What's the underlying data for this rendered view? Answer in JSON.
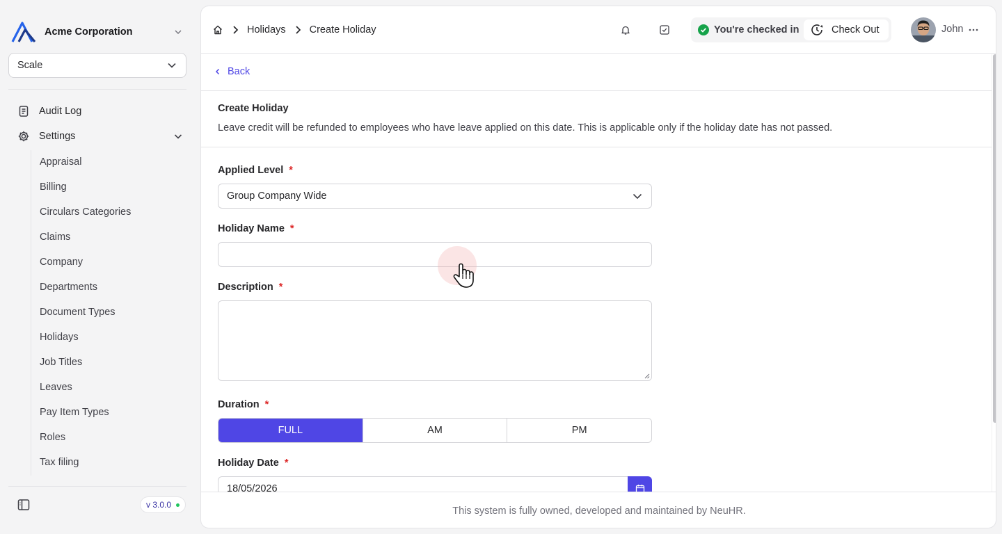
{
  "sidebar": {
    "org_name": "Acme Corporation",
    "plan_select": "Scale",
    "nav": [
      {
        "label": "Audit Log",
        "icon": "document-icon"
      },
      {
        "label": "Settings",
        "icon": "gear-icon"
      }
    ],
    "settings_items": [
      "Appraisal",
      "Billing",
      "Circulars Categories",
      "Claims",
      "Company",
      "Departments",
      "Document Types",
      "Holidays",
      "Job Titles",
      "Leaves",
      "Pay Item Types",
      "Roles",
      "Tax filing"
    ],
    "version": "v 3.0.0"
  },
  "topbar": {
    "breadcrumbs": [
      "Holidays",
      "Create Holiday"
    ],
    "checkin_status": "You're checked in",
    "checkout_label": "Check Out",
    "user_name": "John"
  },
  "form": {
    "back_label": "Back",
    "title": "Create Holiday",
    "description": "Leave credit will be refunded to employees who have leave applied on this date. This is applicable only if the holiday date has not passed.",
    "applied_level": {
      "label": "Applied Level",
      "value": "Group Company Wide"
    },
    "holiday_name": {
      "label": "Holiday Name",
      "value": ""
    },
    "description_field": {
      "label": "Description",
      "value": ""
    },
    "duration": {
      "label": "Duration",
      "options": [
        "FULL",
        "AM",
        "PM"
      ],
      "selected": "FULL"
    },
    "holiday_date": {
      "label": "Holiday Date",
      "value": "18/05/2026"
    },
    "required_mark": "*"
  },
  "footer": {
    "text": "This system is fully owned, developed and maintained by NeuHR."
  },
  "colors": {
    "accent": "#4f46e5",
    "required": "#dc2626",
    "success": "#16a34a"
  }
}
